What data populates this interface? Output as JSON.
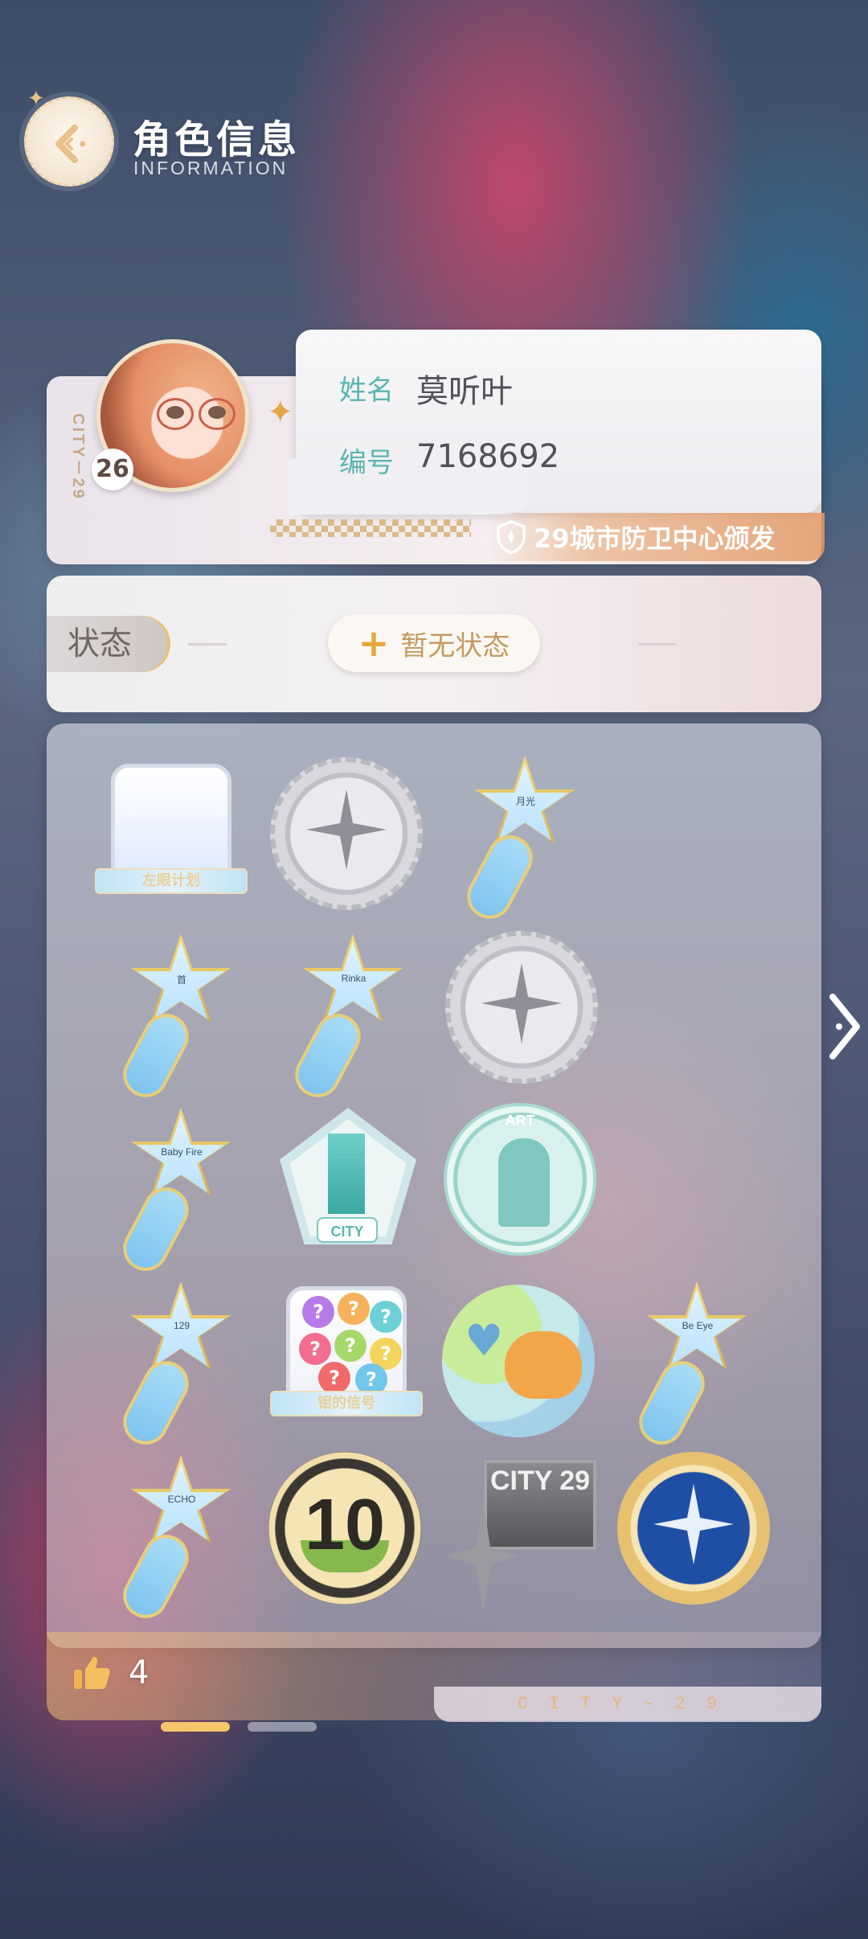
{
  "header": {
    "title": "角色信息",
    "subtitle": "INFORMATION"
  },
  "id_card": {
    "vertical_text": "CITY－29",
    "level": "26",
    "name_label": "姓名",
    "name_value": "莫听叶",
    "id_label": "编号",
    "id_value": "7168692",
    "issuer": "29城市防卫中心颁发"
  },
  "status": {
    "label": "状态",
    "button_label": "暂无状态"
  },
  "badges": [
    {
      "kind": "shield",
      "ribbon": "左眼计划"
    },
    {
      "kind": "silver-medal"
    },
    {
      "kind": "star",
      "text": "月光"
    },
    {
      "kind": "star",
      "text": "首"
    },
    {
      "kind": "star",
      "text": "Rinka"
    },
    {
      "kind": "silver-medal"
    },
    {
      "kind": "star",
      "text": "Baby Fire"
    },
    {
      "kind": "city",
      "text": "CITY"
    },
    {
      "kind": "art",
      "text": "ART"
    },
    {
      "kind": "star",
      "text": "129"
    },
    {
      "kind": "question",
      "ribbon": "钼的信号"
    },
    {
      "kind": "cat"
    },
    {
      "kind": "star",
      "text": "Be Eye"
    },
    {
      "kind": "star",
      "text": "ECHO"
    },
    {
      "kind": "ten",
      "text": "10"
    },
    {
      "kind": "city29",
      "text": "CITY 29"
    },
    {
      "kind": "gold-medal"
    }
  ],
  "footer": {
    "like_count": "4",
    "city_text": "CITY-29"
  },
  "pagination": {
    "current": 1,
    "total": 2
  },
  "colors": {
    "accent_teal": "#5bb5b1",
    "accent_gold": "#e8a640",
    "issuer_orange": "#e29a68"
  }
}
